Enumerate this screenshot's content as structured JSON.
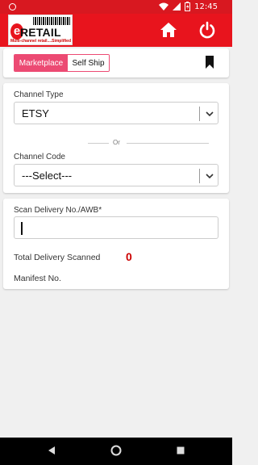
{
  "status_bar": {
    "time": "12:45"
  },
  "app_bar": {
    "logo": {
      "mark": "e",
      "name": "RETAIL",
      "tagline": "Multi-channel retail....Simplified"
    },
    "icons": [
      "home-icon",
      "power-icon"
    ]
  },
  "channel_toggle": {
    "options": [
      "Marketplace",
      "Self Ship"
    ],
    "selected": "Marketplace"
  },
  "channel_form": {
    "channel_type_label": "Channel Type",
    "channel_type_value": "ETSY",
    "or_text": "Or",
    "channel_code_label": "Channel Code",
    "channel_code_value": "---Select---"
  },
  "scan": {
    "label": "Scan Delivery No./AWB*",
    "value": "",
    "total_label": "Total Delivery Scanned",
    "total_count": "0",
    "manifest_label": "Manifest No."
  },
  "colors": {
    "primary": "#e8141d",
    "accent": "#ec4a73",
    "count": "#cc0000"
  }
}
